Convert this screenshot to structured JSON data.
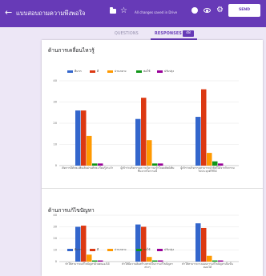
{
  "topbar": {
    "back_icon": "arrow-left-icon",
    "title": "แบบสอบถามความพึงพอใจ",
    "folder_icon": "folder-icon",
    "star_icon": "star-icon",
    "saved_status": "All changes saved in Drive",
    "palette_icon": "palette-icon",
    "preview_icon": "eye-icon",
    "settings_icon": "gear-icon",
    "send_label": "SEND",
    "color": "#673ab7"
  },
  "tabs": {
    "questions": "QUESTIONS",
    "responses": "RESPONSES",
    "responses_count": "48"
  },
  "sections": [
    {
      "title": "ด้านการเคลื่อนไหวรู้",
      "legend": [
        "ดีมาก",
        "ดี",
        "ปานกลาง",
        "พอใช้",
        "ปรับปรุง"
      ],
      "chart_data": {
        "type": "bar",
        "categories": [
          "เกิดการมีทักษะเพิ่มเติมผ่านทักษะเรียนรู้ประจำ",
          "ผู้เข้าร่วมกิจกรรมความรู้ความเข้าใจผลลัพธ์เพิ่มขึ้นจากกิจกรรมนี้",
          "ผู้เข้าร่วมกิจกรรมสามารถนำสิ่งที่ได้จากกิจกรรมไปประยุกต์ใช้ได้"
        ],
        "series": [
          {
            "name": "ดีมาก",
            "color": "#3366cc",
            "values": [
              26,
              22,
              23
            ]
          },
          {
            "name": "ดี",
            "color": "#dc3912",
            "values": [
              26,
              32,
              36
            ]
          },
          {
            "name": "ปานกลาง",
            "color": "#ff9900",
            "values": [
              14,
              12,
              6
            ]
          },
          {
            "name": "พอใช้",
            "color": "#109618",
            "values": [
              1,
              1,
              2
            ]
          },
          {
            "name": "ปรับปรุง",
            "color": "#990099",
            "values": [
              1,
              1,
              1
            ]
          }
        ],
        "y_ticks": [
          "0",
          "10",
          "20",
          "30",
          "40"
        ],
        "ylim": [
          0,
          40
        ],
        "grid": true,
        "legend_position": "top"
      }
    },
    {
      "title": "ด้านการแก้ไขปัญหา",
      "legend": [
        "ดีมาก",
        "ดี",
        "ปานกลาง",
        "พอใช้",
        "ปรับปรุง"
      ],
      "chart_data": {
        "type": "bar",
        "categories": [
          "ทำให้สามารถแก้ไขปัญหาด้วยตนเองได้",
          "ทำให้มีความคิดสร้างสรรค์ในการแก้ไขปัญหาต่างๆ",
          "ทำให้สามารถวางแผนการแก้ไขปัญหาเป็นขั้นตอนได้"
        ],
        "series": [
          {
            "name": "ดีมาก",
            "color": "#3366cc",
            "values": [
              30,
              32,
              33
            ]
          },
          {
            "name": "ดี",
            "color": "#dc3912",
            "values": [
              31,
              30,
              29
            ]
          },
          {
            "name": "ปานกลาง",
            "color": "#ff9900",
            "values": [
              6,
              4,
              5
            ]
          },
          {
            "name": "พอใช้",
            "color": "#109618",
            "values": [
              1,
              1,
              1
            ]
          },
          {
            "name": "ปรับปรุง",
            "color": "#990099",
            "values": [
              1,
              1,
              1
            ]
          }
        ],
        "y_ticks": [
          "0",
          "10",
          "20",
          "30",
          "40"
        ],
        "ylim": [
          0,
          40
        ],
        "grid": true,
        "legend_position": "top"
      }
    }
  ]
}
